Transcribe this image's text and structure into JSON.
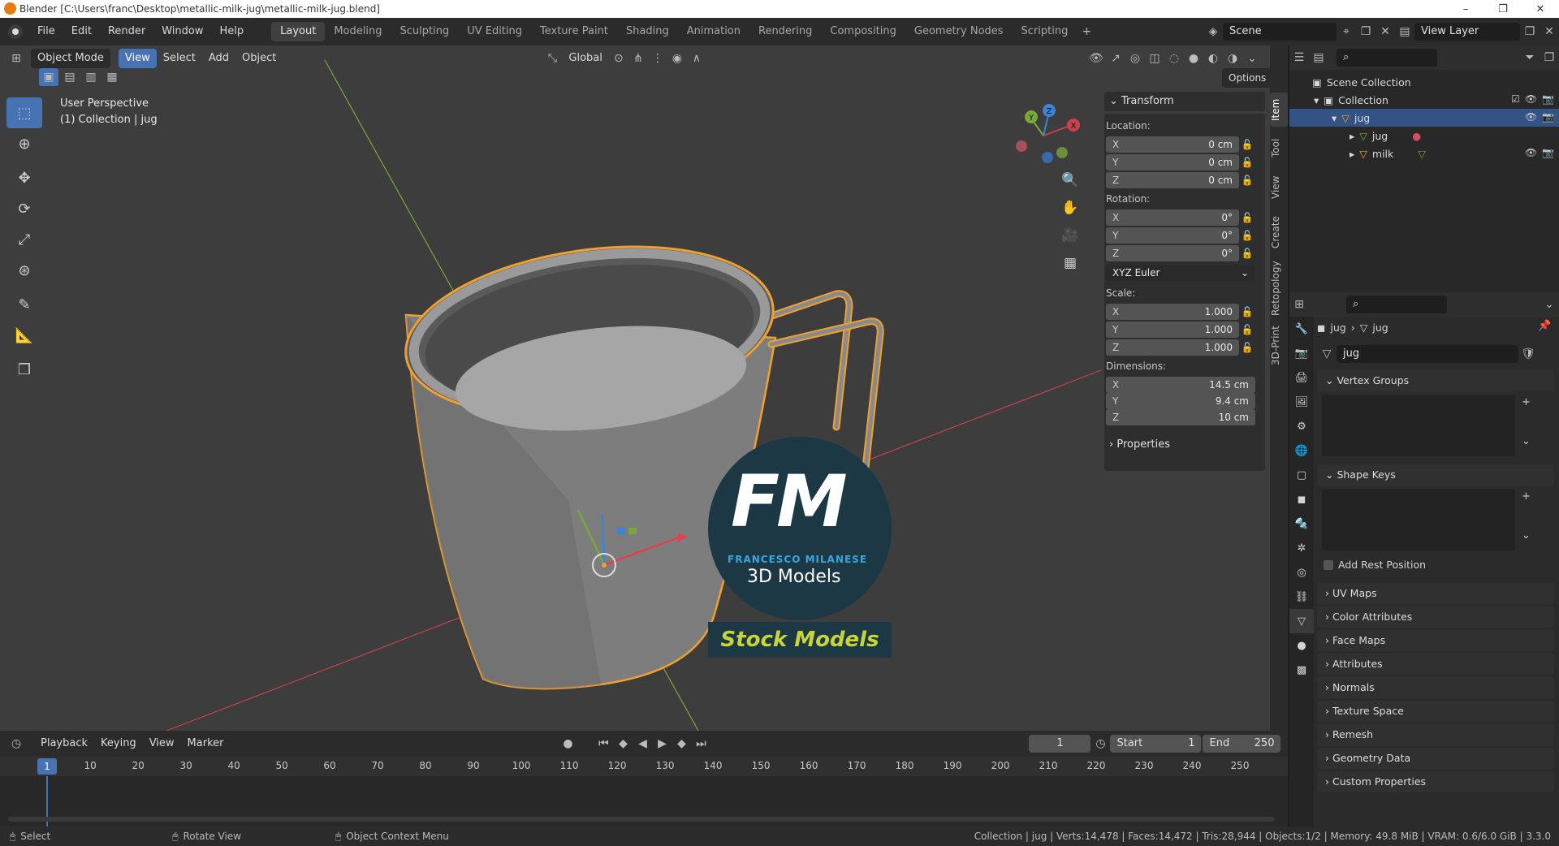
{
  "window": {
    "title": "Blender [C:\\Users\\franc\\Desktop\\metallic-milk-jug\\metallic-milk-jug.blend]",
    "controls": [
      "–",
      "❐",
      "✕"
    ]
  },
  "menu": [
    "File",
    "Edit",
    "Render",
    "Window",
    "Help"
  ],
  "workspaces": [
    "Layout",
    "Modeling",
    "Sculpting",
    "UV Editing",
    "Texture Paint",
    "Shading",
    "Animation",
    "Rendering",
    "Compositing",
    "Geometry Nodes",
    "Scripting"
  ],
  "scene": "Scene",
  "view_layer": "View Layer",
  "viewport": {
    "mode": "Object Mode",
    "menus": [
      "View",
      "Select",
      "Add",
      "Object"
    ],
    "orientation": "Global",
    "options": "Options",
    "perspective": "User Perspective",
    "collection_info": "(1) Collection | jug"
  },
  "gizmo_axes": {
    "x": "X",
    "y": "Y",
    "z": "Z"
  },
  "transform": {
    "title": "Transform",
    "location_label": "Location:",
    "location": [
      {
        "axis": "X",
        "value": "0 cm"
      },
      {
        "axis": "Y",
        "value": "0 cm"
      },
      {
        "axis": "Z",
        "value": "0 cm"
      }
    ],
    "rotation_label": "Rotation:",
    "rotation": [
      {
        "axis": "X",
        "value": "0°"
      },
      {
        "axis": "Y",
        "value": "0°"
      },
      {
        "axis": "Z",
        "value": "0°"
      }
    ],
    "rotation_mode": "XYZ Euler",
    "scale_label": "Scale:",
    "scale": [
      {
        "axis": "X",
        "value": "1.000"
      },
      {
        "axis": "Y",
        "value": "1.000"
      },
      {
        "axis": "Z",
        "value": "1.000"
      }
    ],
    "dimensions_label": "Dimensions:",
    "dimensions": [
      {
        "axis": "X",
        "value": "14.5 cm"
      },
      {
        "axis": "Y",
        "value": "9.4 cm"
      },
      {
        "axis": "Z",
        "value": "10 cm"
      }
    ],
    "properties": "Properties"
  },
  "side_tabs": [
    "Item",
    "Tool",
    "View",
    "Create",
    "Retopology",
    "3D-Print"
  ],
  "outliner": {
    "scene_collection": "Scene Collection",
    "collection": "Collection",
    "items": [
      {
        "name": "jug",
        "level": 2
      },
      {
        "name": "jug",
        "level": 3
      },
      {
        "name": "milk",
        "level": 3
      }
    ]
  },
  "properties": {
    "breadcrumb_object": "jug",
    "breadcrumb_data": "jug",
    "datablock": "jug",
    "sections": [
      "Vertex Groups",
      "Shape Keys",
      "UV Maps",
      "Color Attributes",
      "Face Maps",
      "Attributes",
      "Normals",
      "Texture Space",
      "Remesh",
      "Geometry Data",
      "Custom Properties"
    ],
    "add_rest_position": "Add Rest Position"
  },
  "timeline": {
    "menus": [
      "Playback",
      "Keying",
      "View",
      "Marker"
    ],
    "current_frame": "1",
    "start_label": "Start",
    "start": "1",
    "end_label": "End",
    "end": "250",
    "ticks": [
      "10",
      "20",
      "30",
      "40",
      "50",
      "60",
      "70",
      "80",
      "90",
      "100",
      "110",
      "120",
      "130",
      "140",
      "150",
      "160",
      "170",
      "180",
      "190",
      "200",
      "210",
      "220",
      "230",
      "240",
      "250"
    ]
  },
  "status": {
    "select": "Select",
    "rotate": "Rotate View",
    "context": "Object Context Menu",
    "stats": "Collection | jug | Verts:14,478 | Faces:14,472 | Tris:28,944 | Objects:1/2 | Memory: 49.8 MiB | VRAM: 0.6/6.0 GiB | 3.3.0"
  },
  "watermark": {
    "initials": "FM",
    "name": "FRANCESCO MILANESE",
    "subtitle": "3D Models",
    "banner": "Stock Models"
  },
  "colors": {
    "accent": "#4772b3",
    "selection_outline": "#f0a030",
    "viewport_bg": "#3d3d3d",
    "x_axis": "#c8434e",
    "y_axis": "#7aa83a",
    "z_axis": "#3c84d8"
  }
}
